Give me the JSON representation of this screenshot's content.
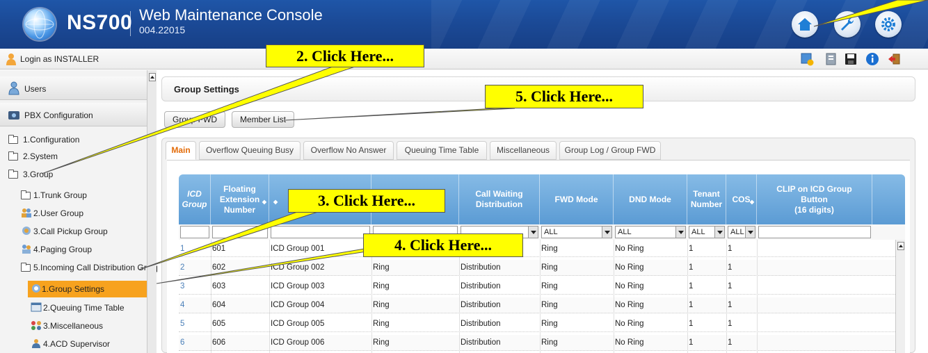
{
  "header": {
    "brand": "NS700",
    "console_title": "Web Maintenance Console",
    "version": "004.22015",
    "buttons": [
      "home-icon",
      "wrench-icon",
      "gear-icon"
    ]
  },
  "login": {
    "text": "Login as INSTALLER",
    "tools": [
      "download-icon",
      "address-book-icon",
      "save-icon",
      "info-icon",
      "logout-icon"
    ]
  },
  "sidebar": {
    "sections": [
      {
        "label": "Users"
      },
      {
        "label": "PBX Configuration"
      }
    ],
    "items": [
      {
        "label": "1.Configuration"
      },
      {
        "label": "2.System"
      },
      {
        "label": "3.Group"
      },
      {
        "label": "1.Trunk Group"
      },
      {
        "label": "2.User Group"
      },
      {
        "label": "3.Call Pickup Group"
      },
      {
        "label": "4.Paging Group"
      },
      {
        "label": "5.Incoming Call Distribution Group"
      },
      {
        "label": "1.Group Settings"
      },
      {
        "label": "2.Queuing Time Table"
      },
      {
        "label": "3.Miscellaneous"
      },
      {
        "label": "4.ACD Supervisor"
      }
    ]
  },
  "main": {
    "title": "Group Settings",
    "buttons": {
      "group_fwd": "Group FWD",
      "member_list": "Member List"
    },
    "tabs": [
      {
        "label": "Main"
      },
      {
        "label": "Overflow Queuing Busy"
      },
      {
        "label": "Overflow No Answer"
      },
      {
        "label": "Queuing Time Table"
      },
      {
        "label": "Miscellaneous"
      },
      {
        "label": "Group Log / Group FWD"
      }
    ],
    "columns": [
      {
        "l1": "ICD",
        "l2": "Group",
        "l3": ""
      },
      {
        "l1": "Floating",
        "l2": "Extension",
        "l3": "Number"
      },
      {
        "l1": "",
        "l2": "",
        "l3": ""
      },
      {
        "l1": "",
        "l2": "",
        "l3": ""
      },
      {
        "l1": "Call Waiting",
        "l2": "Distribution",
        "l3": ""
      },
      {
        "l1": "FWD Mode",
        "l2": "",
        "l3": ""
      },
      {
        "l1": "DND Mode",
        "l2": "",
        "l3": ""
      },
      {
        "l1": "Tenant",
        "l2": "Number",
        "l3": ""
      },
      {
        "l1": "COS",
        "l2": "",
        "l3": ""
      },
      {
        "l1": "CLIP on ICD Group",
        "l2": "Button",
        "l3": "(16 digits)"
      }
    ],
    "filters": {
      "call_waiting": "",
      "fwd_mode": "ALL",
      "dnd_mode": "ALL",
      "tenant": "ALL",
      "cos": "ALL"
    },
    "rows": [
      {
        "icd": "1",
        "ext": "601",
        "name": "ICD Group 001",
        "ring": "",
        "dist": "",
        "fwd": "Ring",
        "dnd": "No Ring",
        "tenant": "1",
        "cos": "1"
      },
      {
        "icd": "2",
        "ext": "602",
        "name": "ICD Group 002",
        "ring": "Ring",
        "dist": "Distribution",
        "fwd": "Ring",
        "dnd": "No Ring",
        "tenant": "1",
        "cos": "1"
      },
      {
        "icd": "3",
        "ext": "603",
        "name": "ICD Group 003",
        "ring": "Ring",
        "dist": "Distribution",
        "fwd": "Ring",
        "dnd": "No Ring",
        "tenant": "1",
        "cos": "1"
      },
      {
        "icd": "4",
        "ext": "604",
        "name": "ICD Group 004",
        "ring": "Ring",
        "dist": "Distribution",
        "fwd": "Ring",
        "dnd": "No Ring",
        "tenant": "1",
        "cos": "1"
      },
      {
        "icd": "5",
        "ext": "605",
        "name": "ICD Group 005",
        "ring": "Ring",
        "dist": "Distribution",
        "fwd": "Ring",
        "dnd": "No Ring",
        "tenant": "1",
        "cos": "1"
      },
      {
        "icd": "6",
        "ext": "606",
        "name": "ICD Group 006",
        "ring": "Ring",
        "dist": "Distribution",
        "fwd": "Ring",
        "dnd": "No Ring",
        "tenant": "1",
        "cos": "1"
      }
    ]
  },
  "callouts": {
    "c2": "2. Click Here...",
    "c3": "3. Click Here...",
    "c4": "4. Click Here...",
    "c5": "5. Click Here..."
  },
  "colors": {
    "header_blue": "#1b4a97",
    "grid_header_blue": "#5b9bd4",
    "active_orange": "#f7a21e",
    "callout_yellow": "#ffff00",
    "active_tab_text": "#e36c0a"
  }
}
